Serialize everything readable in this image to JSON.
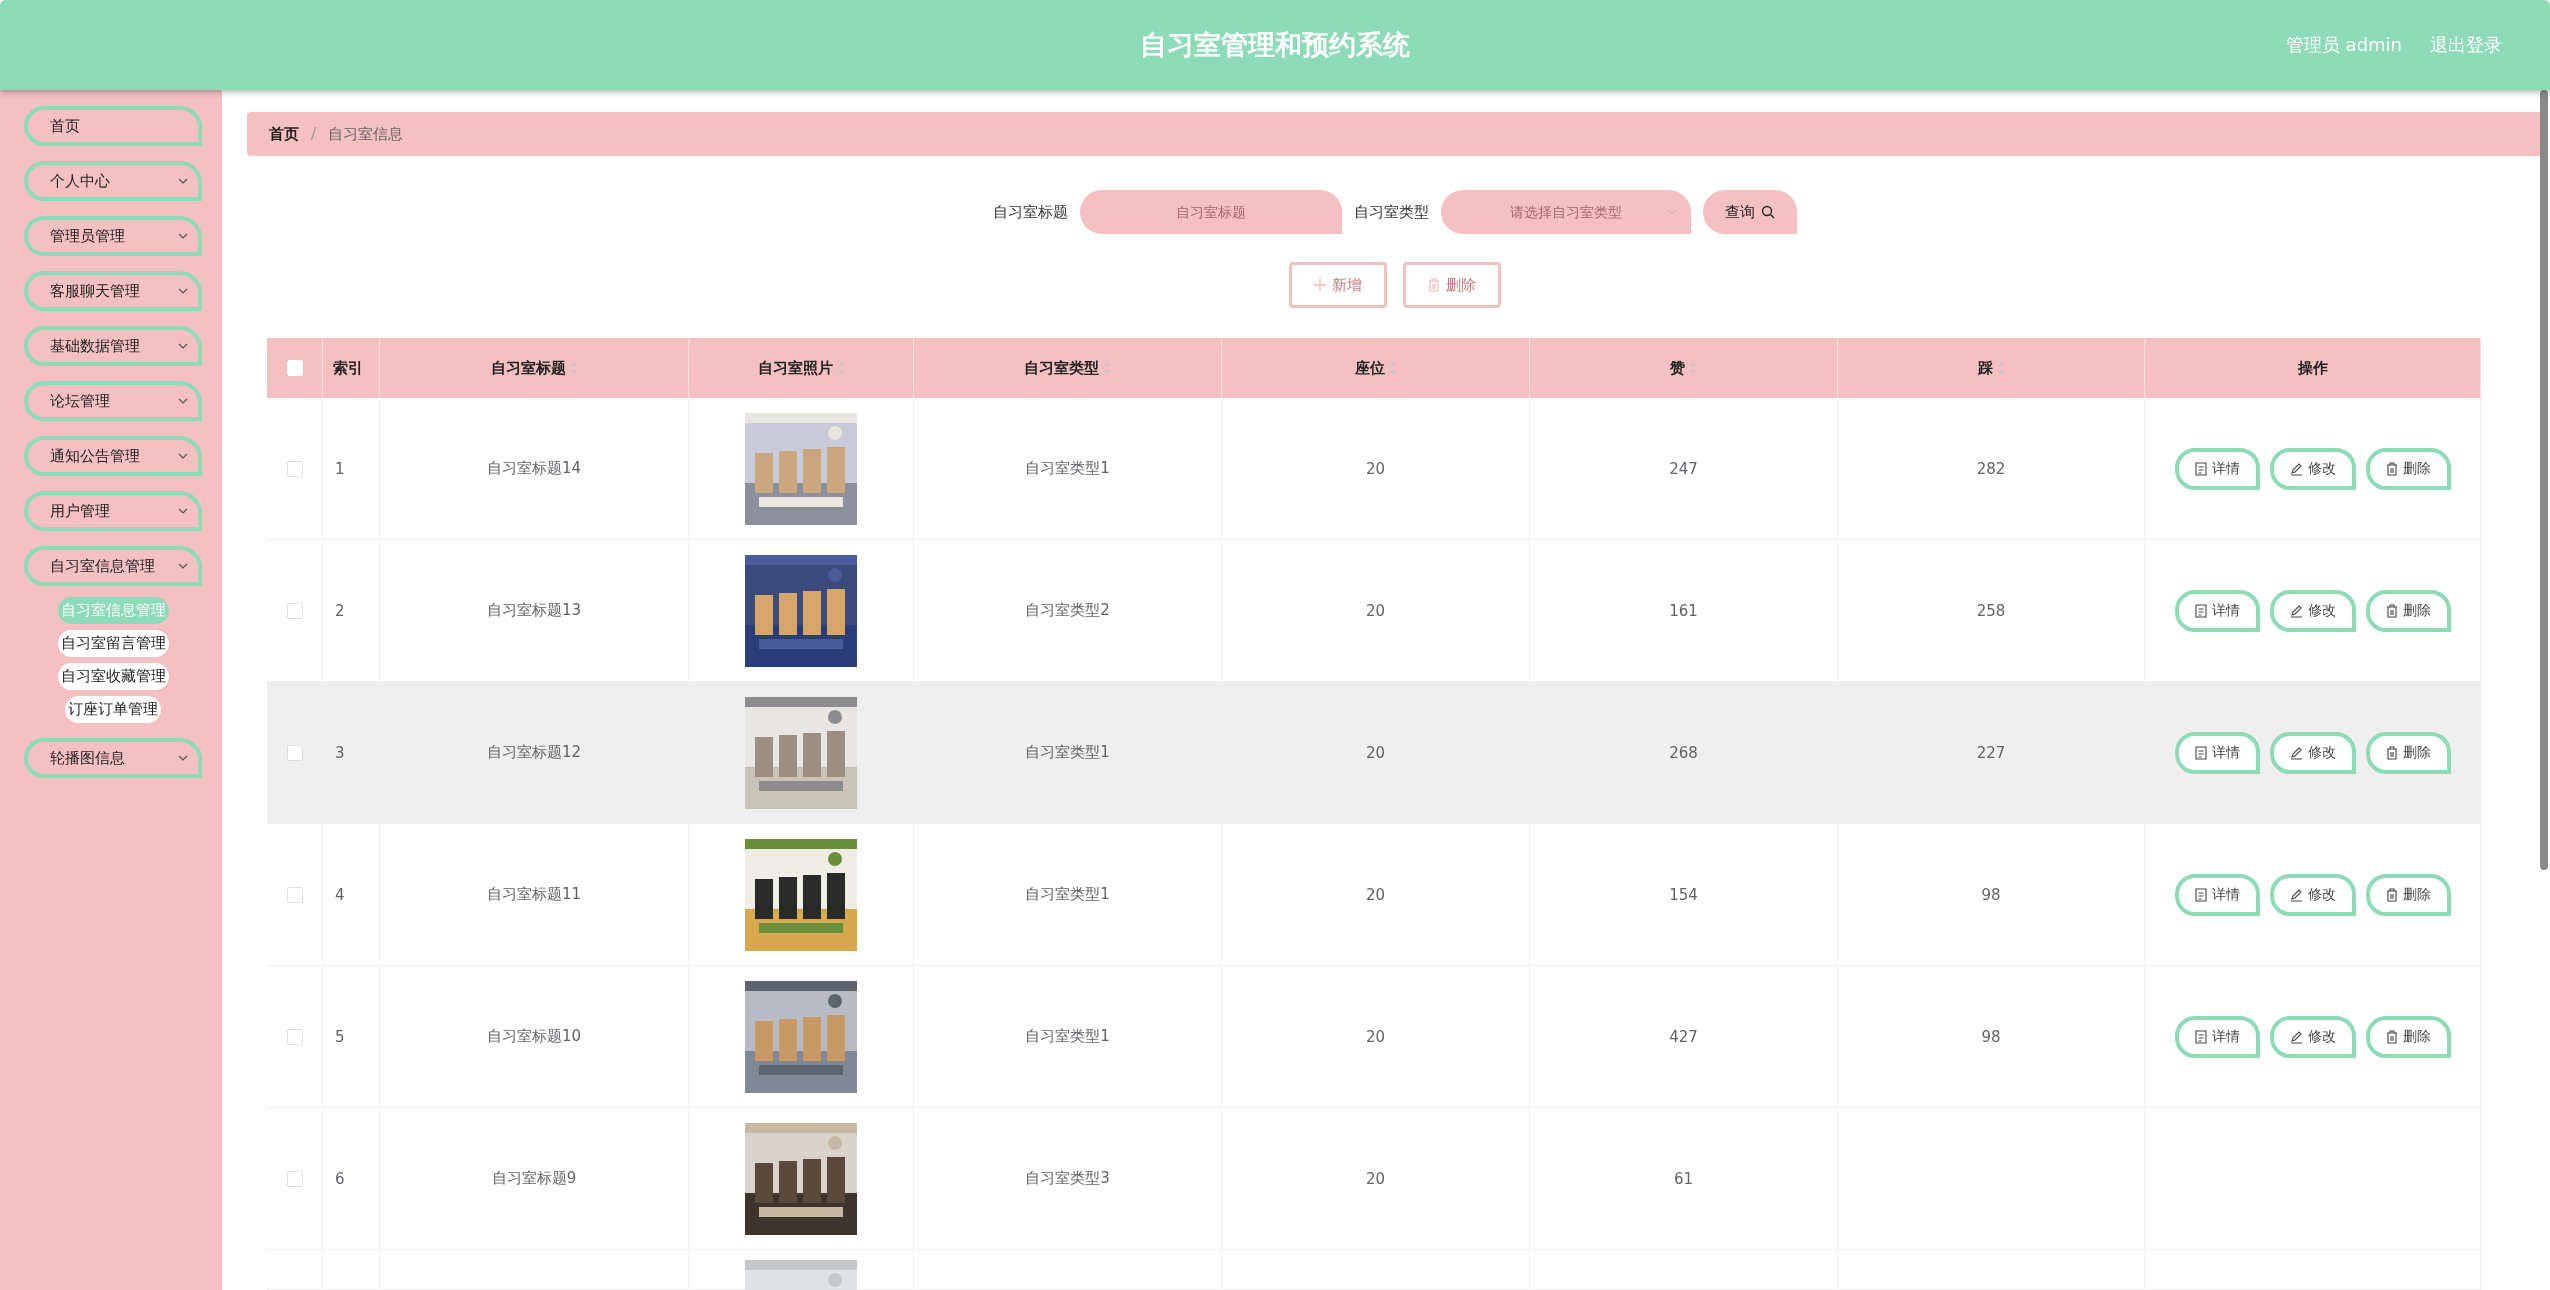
{
  "header": {
    "title": "自习室管理和预约系统",
    "user": "管理员 admin",
    "logout": "退出登录"
  },
  "sidebar": {
    "items": [
      {
        "label": "首页",
        "expandable": false
      },
      {
        "label": "个人中心",
        "expandable": true
      },
      {
        "label": "管理员管理",
        "expandable": true
      },
      {
        "label": "客服聊天管理",
        "expandable": true
      },
      {
        "label": "基础数据管理",
        "expandable": true
      },
      {
        "label": "论坛管理",
        "expandable": true
      },
      {
        "label": "通知公告管理",
        "expandable": true
      },
      {
        "label": "用户管理",
        "expandable": true
      },
      {
        "label": "自习室信息管理",
        "expandable": true,
        "children": [
          {
            "label": "自习室信息管理",
            "selected": true
          },
          {
            "label": "自习室留言管理",
            "selected": false
          },
          {
            "label": "自习室收藏管理",
            "selected": false
          },
          {
            "label": "订座订单管理",
            "selected": false
          }
        ]
      },
      {
        "label": "轮播图信息",
        "expandable": true
      }
    ]
  },
  "breadcrumb": {
    "separator": "/",
    "items": [
      {
        "label": "首页"
      },
      {
        "label": "自习室信息"
      }
    ]
  },
  "search": {
    "fields": [
      {
        "label": "自习室标题",
        "placeholder": "自习室标题",
        "kind": "text"
      },
      {
        "label": "自习室类型",
        "placeholder": "请选择自习室类型",
        "kind": "select"
      }
    ],
    "button": "查询"
  },
  "actions": [
    {
      "label": "新增",
      "kind": "add",
      "disabled": true
    },
    {
      "label": "删除",
      "kind": "delete",
      "disabled": true
    }
  ],
  "table": {
    "select_all": {
      "checked": false
    },
    "columns": [
      {
        "label": "索引",
        "sortable": false
      },
      {
        "label": "自习室标题",
        "sortable": true
      },
      {
        "label": "自习室照片",
        "sortable": true
      },
      {
        "label": "自习室类型",
        "sortable": true
      },
      {
        "label": "座位",
        "sortable": true
      },
      {
        "label": "赞",
        "sortable": true
      },
      {
        "label": "踩",
        "sortable": true
      },
      {
        "label": "操作",
        "sortable": false
      }
    ],
    "rows": [
      {
        "checked": false,
        "highlighted": false,
        "index": "1",
        "title": "自习室标题14",
        "photo": {
          "kind": "picture"
        },
        "type": "自习室类型1",
        "seats": "20",
        "likes": "247",
        "dislikes": "282",
        "buttons": [
          {
            "label": "详情",
            "kind": "detail"
          },
          {
            "label": "修改",
            "kind": "edit"
          },
          {
            "label": "删除",
            "kind": "delete"
          }
        ]
      },
      {
        "checked": false,
        "highlighted": false,
        "index": "2",
        "title": "自习室标题13",
        "photo": {
          "kind": "picture"
        },
        "type": "自习室类型2",
        "seats": "20",
        "likes": "161",
        "dislikes": "258",
        "buttons": [
          {
            "label": "详情",
            "kind": "detail"
          },
          {
            "label": "修改",
            "kind": "edit"
          },
          {
            "label": "删除",
            "kind": "delete"
          }
        ]
      },
      {
        "checked": false,
        "highlighted": true,
        "index": "3",
        "title": "自习室标题12",
        "photo": {
          "kind": "picture"
        },
        "type": "自习室类型1",
        "seats": "20",
        "likes": "268",
        "dislikes": "227",
        "buttons": [
          {
            "label": "详情",
            "kind": "detail"
          },
          {
            "label": "修改",
            "kind": "edit"
          },
          {
            "label": "删除",
            "kind": "delete"
          }
        ]
      },
      {
        "checked": false,
        "highlighted": false,
        "index": "4",
        "title": "自习室标题11",
        "photo": {
          "kind": "picture"
        },
        "type": "自习室类型1",
        "seats": "20",
        "likes": "154",
        "dislikes": "98",
        "buttons": [
          {
            "label": "详情",
            "kind": "detail"
          },
          {
            "label": "修改",
            "kind": "edit"
          },
          {
            "label": "删除",
            "kind": "delete"
          }
        ]
      },
      {
        "checked": false,
        "highlighted": false,
        "index": "5",
        "title": "自习室标题10",
        "photo": {
          "kind": "picture"
        },
        "type": "自习室类型1",
        "seats": "20",
        "likes": "427",
        "dislikes": "98",
        "buttons": [
          {
            "label": "详情",
            "kind": "detail"
          },
          {
            "label": "修改",
            "kind": "edit"
          },
          {
            "label": "删除",
            "kind": "delete"
          }
        ]
      },
      {
        "checked": false,
        "highlighted": false,
        "index": "6",
        "title": "自习室标题9",
        "photo": {
          "kind": "picture"
        },
        "type": "自习室类型3",
        "seats": "20",
        "likes": "61"
      },
      {
        "photo": {
          "kind": "picture"
        }
      }
    ]
  }
}
